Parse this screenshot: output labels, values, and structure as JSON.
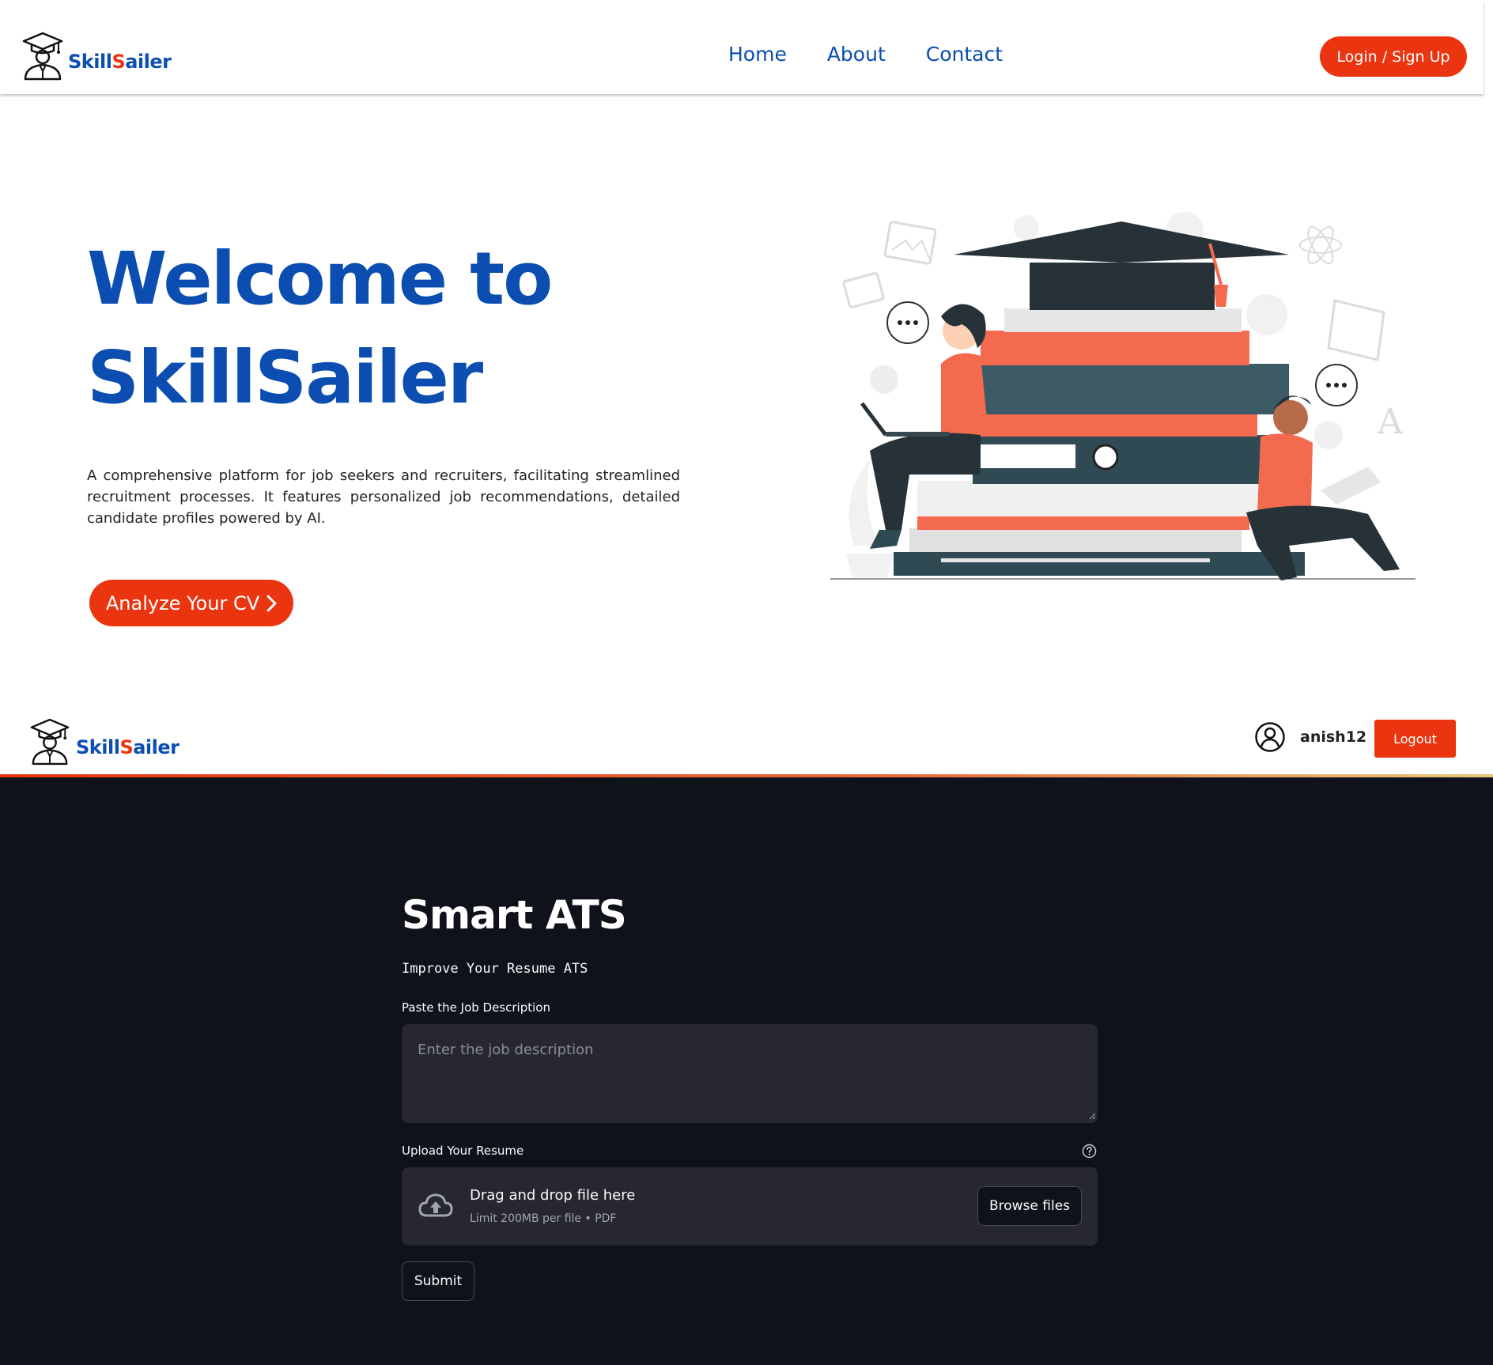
{
  "brand": {
    "name_part1": "Skill",
    "name_s": "S",
    "name_part2": "ailer"
  },
  "top_nav": {
    "links": [
      {
        "label": "Home"
      },
      {
        "label": "About"
      },
      {
        "label": "Contact"
      }
    ],
    "login_label": "Login / Sign Up"
  },
  "hero": {
    "title_line1": "Welcome to",
    "title_line2": "SkillSailer",
    "description": "A comprehensive platform for job seekers and recruiters, facilitating streamlined recruitment processes. It features personalized job recommendations, detailed candidate profiles powered by AI.",
    "cta_label": "Analyze Your CV"
  },
  "app_header": {
    "username": "anish12",
    "logout_label": "Logout"
  },
  "ats": {
    "title": "Smart ATS",
    "subtitle": "Improve Your Resume ATS",
    "jd_label": "Paste the Job Description",
    "jd_placeholder": "Enter the job description",
    "upload_label": "Upload Your Resume",
    "dropzone_title": "Drag and drop file here",
    "dropzone_limit": "Limit 200MB per file • PDF",
    "browse_label": "Browse files",
    "submit_label": "Submit"
  },
  "colors": {
    "brand_blue": "#0b4db0",
    "accent_red": "#ea3510",
    "dark_bg": "#0f121a",
    "input_bg": "#262730"
  },
  "icons": [
    "graduate-logo-icon",
    "user-circle-icon",
    "help-icon",
    "cloud-upload-icon",
    "chevron-right-icon"
  ]
}
